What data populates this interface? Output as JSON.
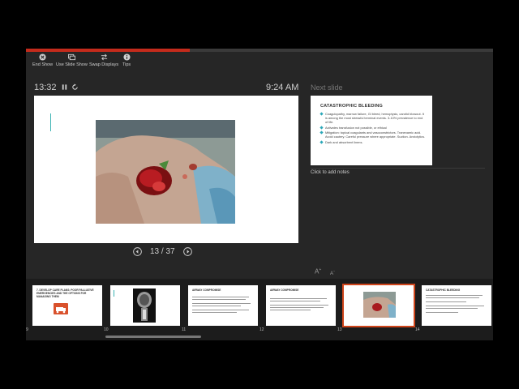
{
  "toolbar": {
    "end_show": "End Show",
    "use_slide_show": "Use Slide Show",
    "swap_displays": "Swap Displays",
    "tips": "Tips"
  },
  "presenter": {
    "elapsed_time": "13:32",
    "clock": "9:24 AM",
    "next_slide_label": "Next slide",
    "slide_counter": "13 / 37",
    "progress": 0.351,
    "notes_placeholder": "Click to add notes",
    "increase_font": "A",
    "decrease_font": "A"
  },
  "next_slide": {
    "title": "CATASTROPHIC BLEEDING",
    "bullets": [
      "Coagulopathy, marrow failure, GI bleed, hemoptysis, carotid blowout. It is among the most stressful terminal events. 3-10% prevalence to end of life.",
      "Activates transfusion not possible, or ethical",
      "Mitigation: topical coagulants and vasoconstrictors. Tranexamic acid. Avoid cautery. Careful pressure where appropriate. Suction. Anxiolytics.",
      "Dark and absorbent linens."
    ]
  },
  "thumbnails": [
    {
      "num": "9",
      "title": "7. DEVELOP CARE PLANS: POOR PALLIATIVE EMERGENCIES AND THE OPTIONS FOR MANAGING THEM"
    },
    {
      "num": "10",
      "title": ""
    },
    {
      "num": "11",
      "title": "AIRWAY COMPROMISE"
    },
    {
      "num": "12",
      "title": "AIRWAY COMPROMISE"
    },
    {
      "num": "13",
      "title": ""
    },
    {
      "num": "14",
      "title": "CATASTROPHIC BLEEDING"
    }
  ],
  "colors": {
    "accent_red": "#c42b1c",
    "selected_outline": "#d0451b",
    "bullet_teal": "#2aa7b8"
  }
}
